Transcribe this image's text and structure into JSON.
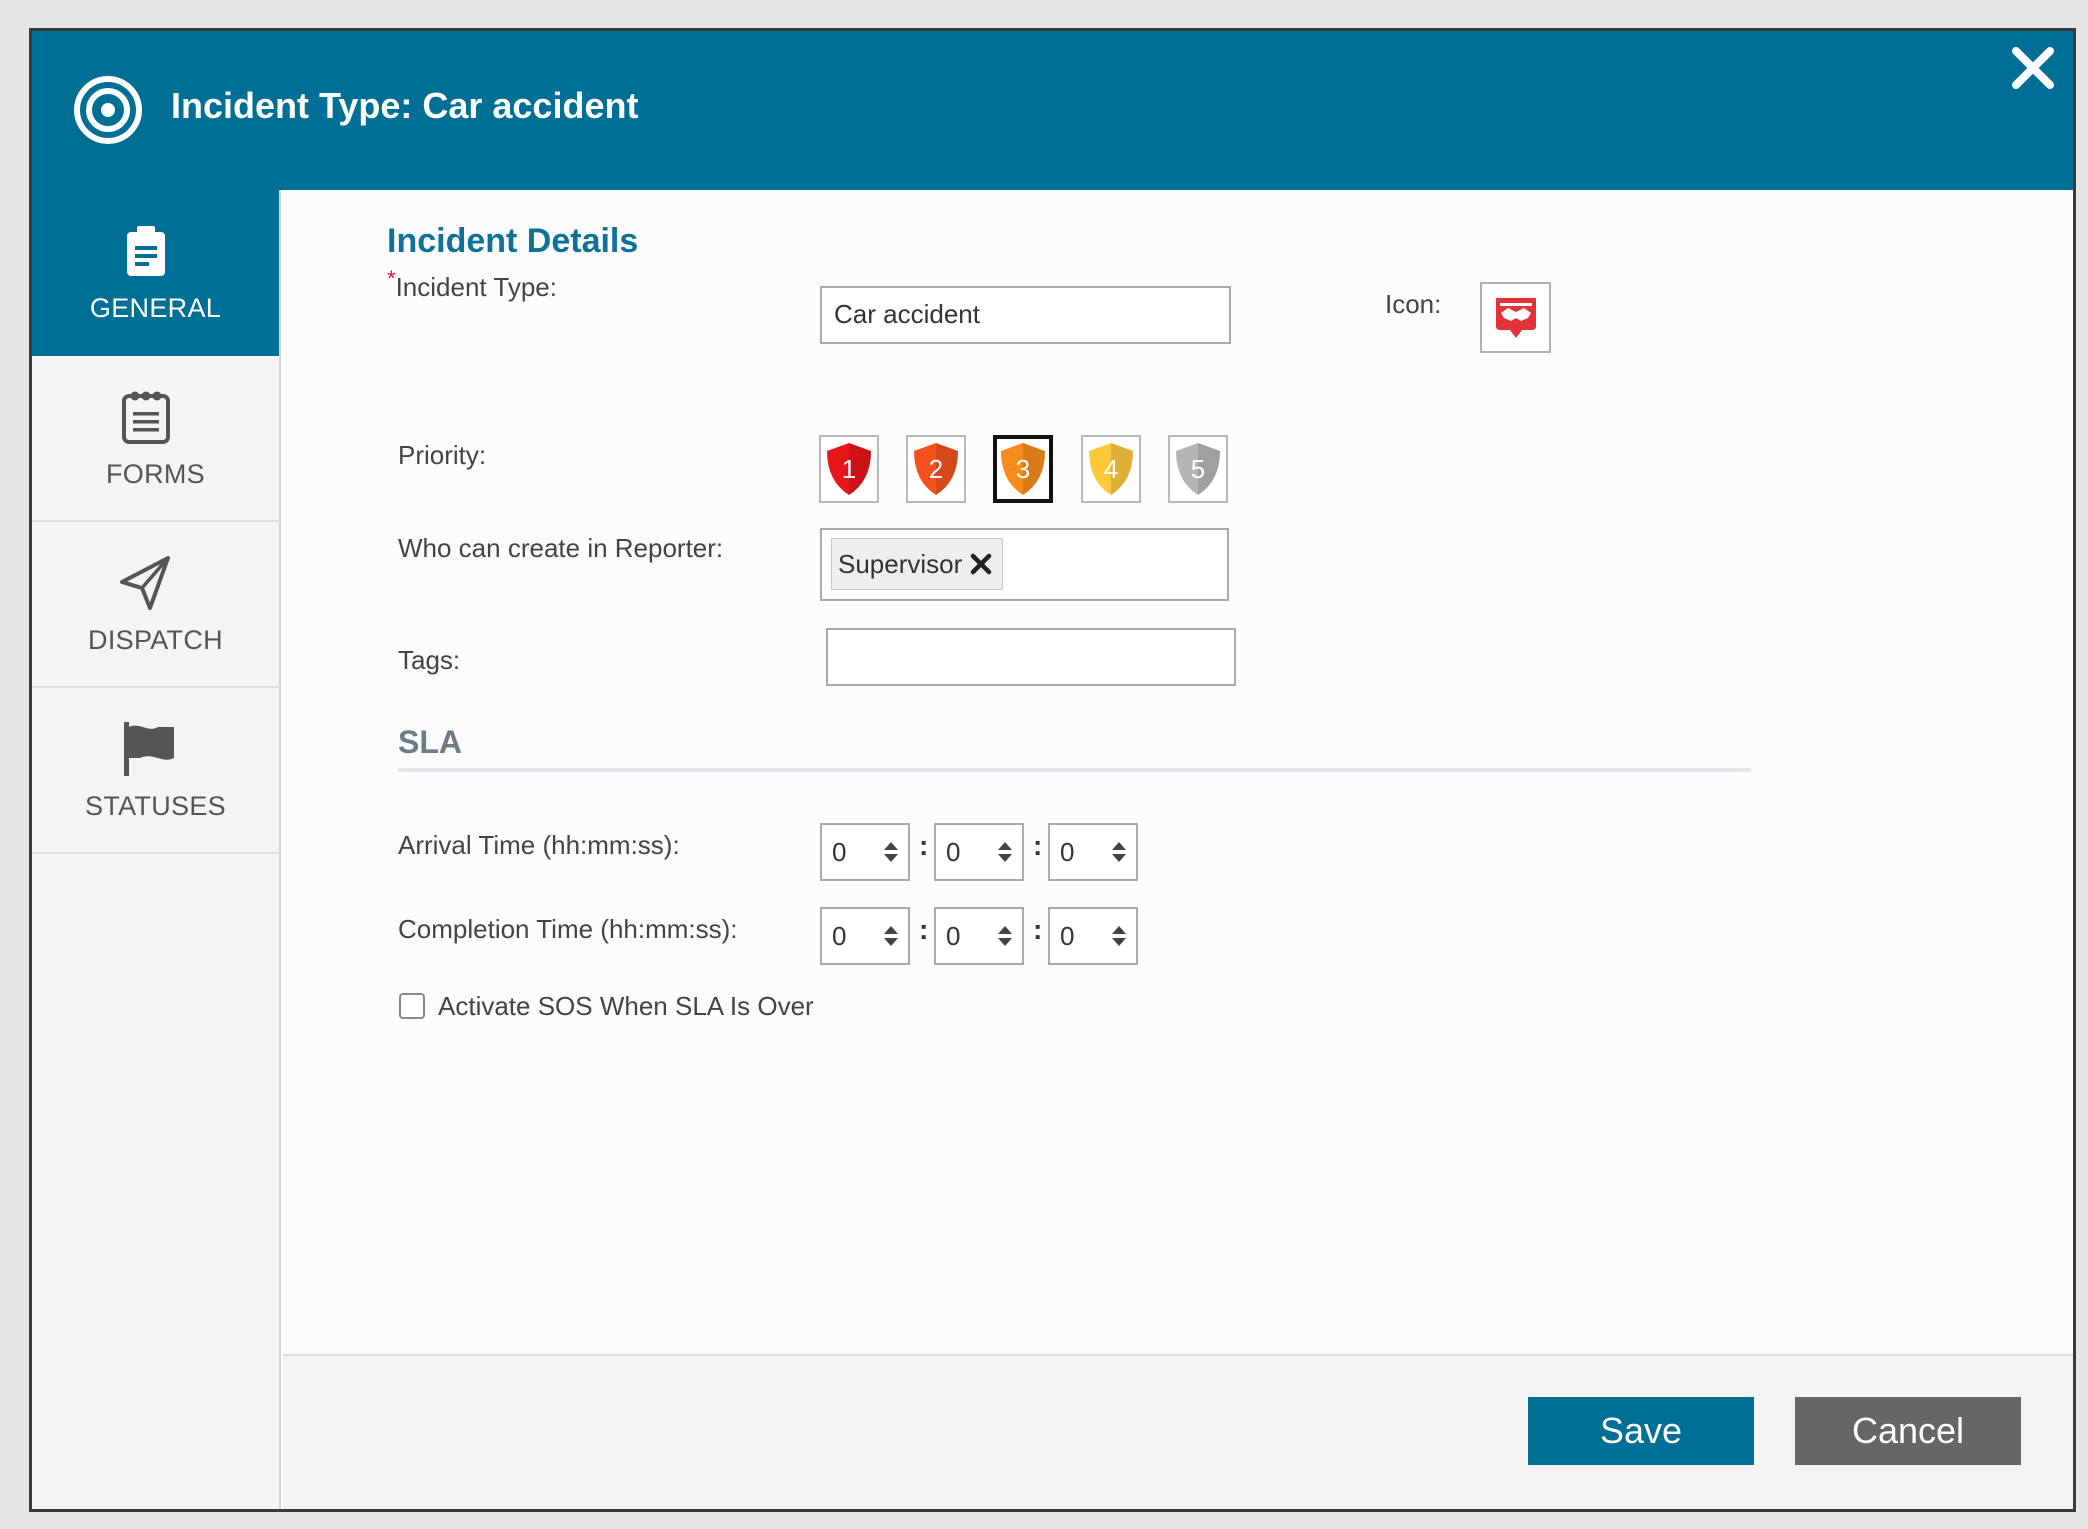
{
  "dialog": {
    "title": "Incident Type: Car accident",
    "logo_icon": "target-icon",
    "close_icon": "close-icon"
  },
  "sidebar": {
    "items": [
      {
        "label": "GENERAL",
        "icon": "clipboard-icon",
        "active": true
      },
      {
        "label": "FORMS",
        "icon": "notepad-icon",
        "active": false
      },
      {
        "label": "DISPATCH",
        "icon": "paper-plane-icon",
        "active": false
      },
      {
        "label": "STATUSES",
        "icon": "flag-icon",
        "active": false
      }
    ]
  },
  "general": {
    "section_title": "Incident Details",
    "incident_type": {
      "required_mark": "*",
      "label": "Incident Type:",
      "value": "Car accident"
    },
    "icon": {
      "label": "Icon:",
      "icon": "car-accident-icon"
    },
    "priority": {
      "label": "Priority:",
      "levels": [
        {
          "value": "1",
          "color": "#e8161b"
        },
        {
          "value": "2",
          "color": "#f4511e"
        },
        {
          "value": "3",
          "color": "#f98b1c"
        },
        {
          "value": "4",
          "color": "#fdc93b"
        },
        {
          "value": "5",
          "color": "#b5b5b5"
        }
      ],
      "selected": "3"
    },
    "reporter": {
      "label": "Who can create in Reporter:",
      "chips": [
        "Supervisor"
      ]
    },
    "tags": {
      "label": "Tags:",
      "value": ""
    }
  },
  "sla": {
    "title": "SLA",
    "arrival": {
      "label": "Arrival Time (hh:mm:ss):",
      "hh": "0",
      "mm": "0",
      "ss": "0"
    },
    "completion": {
      "label": "Completion Time (hh:mm:ss):",
      "hh": "0",
      "mm": "0",
      "ss": "0"
    },
    "separator": ":",
    "sos": {
      "label": "Activate SOS When SLA Is Over",
      "checked": false
    }
  },
  "footer": {
    "save_label": "Save",
    "cancel_label": "Cancel"
  },
  "colors": {
    "brand": "#006f96",
    "section_title": "#0d7199",
    "cancel": "#666666",
    "required": "#d8143a"
  }
}
